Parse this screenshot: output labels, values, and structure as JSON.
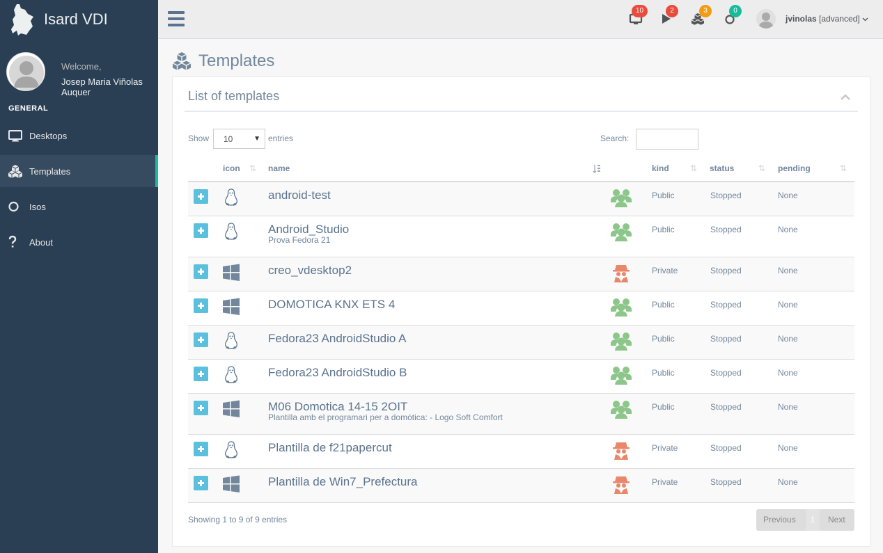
{
  "app": {
    "title": "Isard VDI"
  },
  "profile": {
    "welcome": "Welcome,",
    "name": "Josep Maria Viñolas Auquer"
  },
  "sidebar": {
    "section": "GENERAL",
    "items": [
      {
        "label": "Desktops",
        "icon": "desktop-icon"
      },
      {
        "label": "Templates",
        "icon": "cubes-icon",
        "active": true
      },
      {
        "label": "Isos",
        "icon": "circle-o-icon"
      },
      {
        "label": "About",
        "icon": "question-icon"
      }
    ]
  },
  "topnav": {
    "badges": [
      {
        "icon": "desktop-icon",
        "count": "10",
        "color": "#E74C3C"
      },
      {
        "icon": "play-icon",
        "count": "2",
        "color": "#E74C3C"
      },
      {
        "icon": "cubes-icon",
        "count": "3",
        "color": "#F39C12"
      },
      {
        "icon": "circle-o-icon",
        "count": "0",
        "color": "#1ABB9C"
      }
    ],
    "user": {
      "name": "jvinolas",
      "role": "[advanced]"
    }
  },
  "page": {
    "title": "Templates"
  },
  "panel": {
    "title": "List of templates",
    "show_label": "Show",
    "entries_value": "10",
    "entries_label": "entries",
    "search_label": "Search:",
    "search_value": "",
    "columns": {
      "icon": "icon",
      "name": "name",
      "kind": "kind",
      "status": "status",
      "pending": "pending"
    },
    "rows": [
      {
        "os": "linux",
        "name": "android-test",
        "desc": "",
        "kind": "Public",
        "status": "Stopped",
        "pending": "None"
      },
      {
        "os": "linux",
        "name": "Android_Studio",
        "desc": "Prova Fedora 21",
        "kind": "Public",
        "status": "Stopped",
        "pending": "None"
      },
      {
        "os": "windows",
        "name": "creo_vdesktop2",
        "desc": "",
        "kind": "Private",
        "status": "Stopped",
        "pending": "None"
      },
      {
        "os": "windows",
        "name": "DOMOTICA KNX ETS 4",
        "desc": "",
        "kind": "Public",
        "status": "Stopped",
        "pending": "None"
      },
      {
        "os": "linux",
        "name": "Fedora23 AndroidStudio A",
        "desc": "",
        "kind": "Public",
        "status": "Stopped",
        "pending": "None"
      },
      {
        "os": "linux",
        "name": "Fedora23 AndroidStudio B",
        "desc": "",
        "kind": "Public",
        "status": "Stopped",
        "pending": "None"
      },
      {
        "os": "windows",
        "name": "M06 Domotica 14-15 2OIT",
        "desc": "Plantilla amb el programari per a domòtica: - Logo Soft Comfort",
        "kind": "Public",
        "status": "Stopped",
        "pending": "None"
      },
      {
        "os": "linux",
        "name": "Plantilla de f21papercut",
        "desc": "",
        "kind": "Private",
        "status": "Stopped",
        "pending": "None"
      },
      {
        "os": "windows",
        "name": "Plantilla de Win7_Prefectura",
        "desc": "",
        "kind": "Private",
        "status": "Stopped",
        "pending": "None"
      }
    ],
    "showing": "Showing 1 to 9 of 9 entries",
    "pager": {
      "prev": "Previous",
      "current": "1",
      "next": "Next"
    }
  },
  "colors": {
    "sidebar": "#2A3F54",
    "accent": "#1ABB9C",
    "plus_button": "#5BC0DE",
    "public": "#8DC68A",
    "private": "#E8876A"
  }
}
